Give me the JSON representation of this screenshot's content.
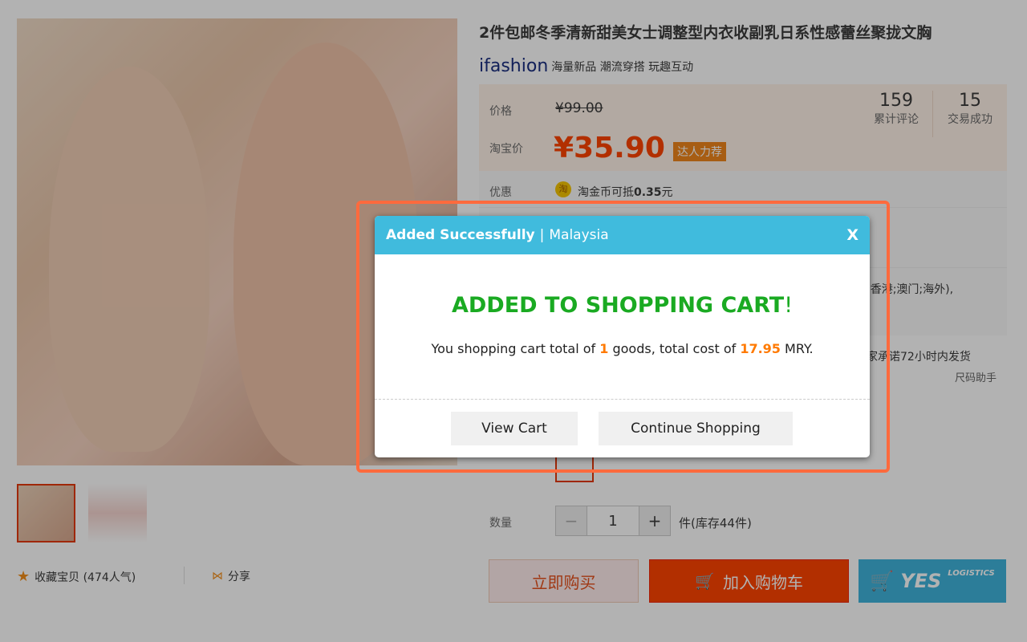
{
  "product": {
    "title": "2件包邮冬季清新甜美女士调整型内衣收副乳日系性感蕾丝聚拢文胸",
    "brand_logo": "ifashion",
    "brand_slogan": "海量新品 潮流穿搭 玩趣互动",
    "price_label": "价格",
    "original_price": "¥99.00",
    "taobao_price_label": "淘宝价",
    "price": "¥35.90",
    "price_tag": "达人力荐",
    "reviews_count": "159",
    "reviews_label": "累计评论",
    "sales_count": "15",
    "sales_label": "交易成功",
    "promo_label": "优惠",
    "coin_icon_text": "淘",
    "promo_text": "淘金币可抵",
    "promo_amount": "0.35",
    "promo_unit": "元",
    "shipping_partial": ";香港;澳门;海外),",
    "delivery_partial": "家承诺72小时内发货",
    "size_helper": "尺码助手",
    "quantity_label": "数量",
    "quantity": "1",
    "stock": "件(库存44件)",
    "buy_now": "立即购买",
    "add_to_cart": "加入购物车",
    "yes_logistics": "YES",
    "yes_sub": "LOGISTICS",
    "favorite": "收藏宝贝 (474人气)",
    "share": "分享"
  },
  "dialog": {
    "header_title": "Added Successfully",
    "header_region": "Malaysia",
    "close": "X",
    "heading": "ADDED TO SHOPPING CART",
    "heading_mark": "!",
    "msg_pre": "You shopping cart total of ",
    "goods_count": "1",
    "msg_mid": " goods, total cost of ",
    "total_cost": "17.95",
    "msg_post": " MRY.",
    "view_cart": "View Cart",
    "continue_shopping": "Continue Shopping"
  },
  "colors": {
    "accent": "#ff4400",
    "dialog_header": "#40bbdd",
    "success": "#1aaa22",
    "highlight_outline": "#ff6a3d"
  }
}
